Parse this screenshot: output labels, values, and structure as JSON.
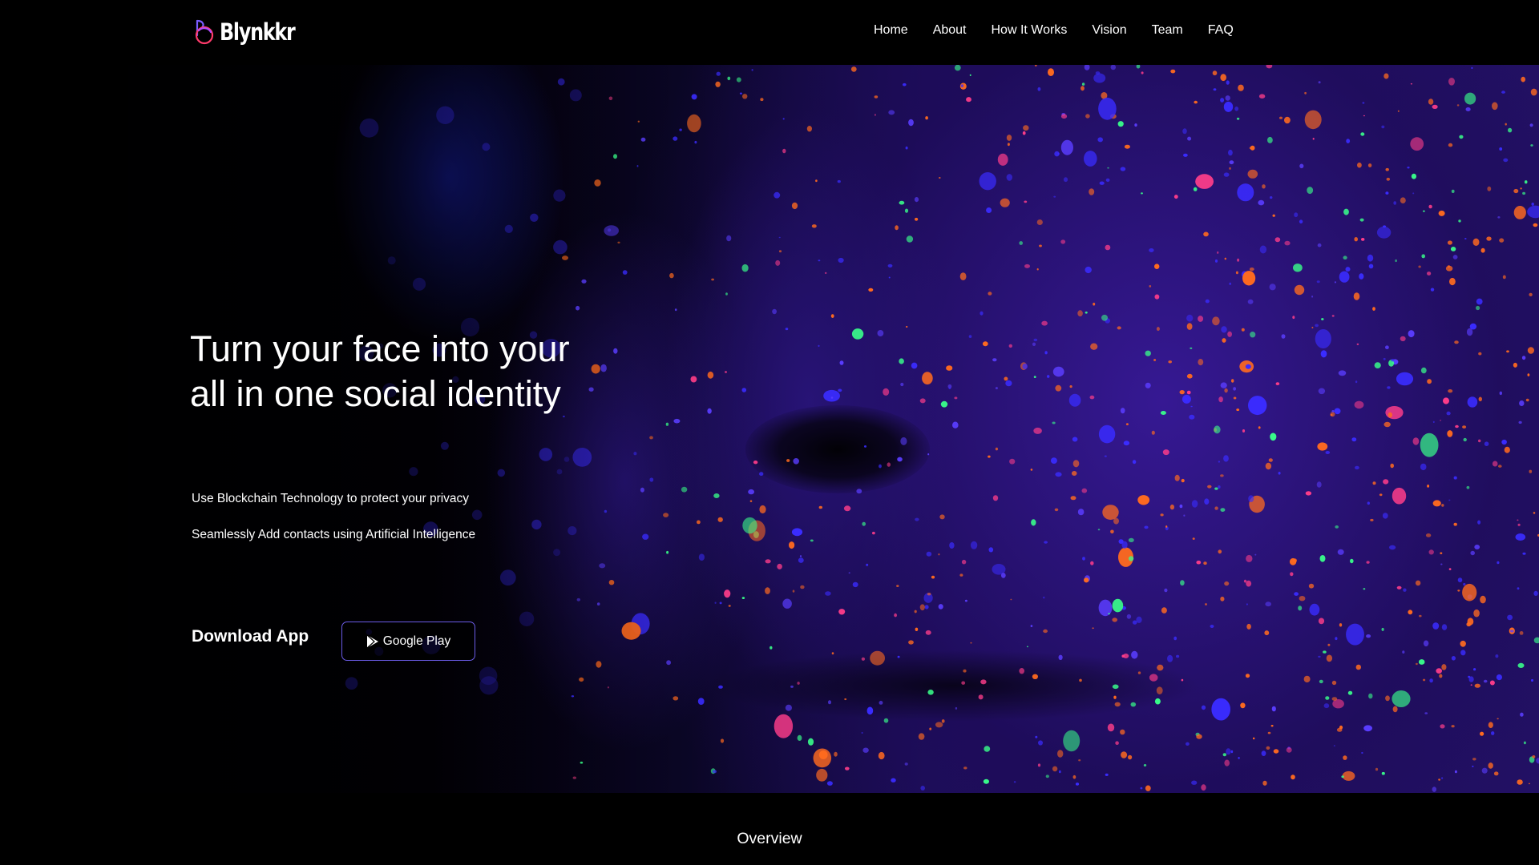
{
  "header": {
    "logo_text": "Blynkkr",
    "logo_icon": "blynkkr-logo-icon",
    "nav": [
      {
        "label": "Home"
      },
      {
        "label": "About"
      },
      {
        "label": "How It Works"
      },
      {
        "label": "Vision"
      },
      {
        "label": "Team"
      },
      {
        "label": "FAQ"
      }
    ]
  },
  "hero": {
    "title": "Turn your face into your all in one social identity",
    "line1": "Use Blockchain Technology to protect your privacy",
    "line2": "Seamlessly Add contacts using Artificial Intelligence",
    "download_label": "Download App",
    "google_play_label": "Google Play",
    "google_play_icon": "play-store-icon",
    "background_image": "face with neon glitter paint"
  },
  "overview": {
    "label": "Overview"
  },
  "colors": {
    "background": "#000000",
    "text": "#ffffff",
    "button_border": "#6b5ce7",
    "glitter_orange": "#ff6a1f",
    "glitter_green": "#39ff8a",
    "glitter_blue": "#3a2cff",
    "skin_purple": "#2a1670"
  }
}
